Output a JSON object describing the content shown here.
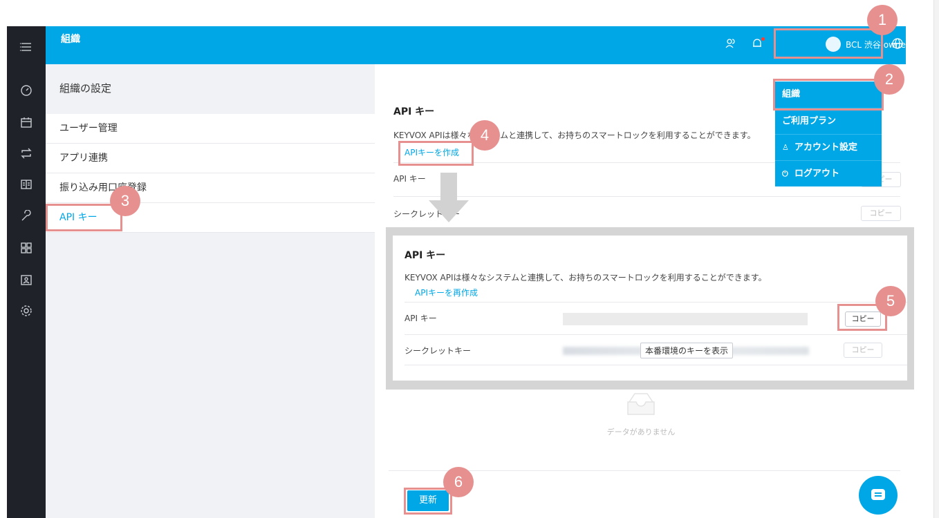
{
  "header": {
    "title": "組織",
    "user_name": "BCL 渋谷 owner",
    "chevron": "∨"
  },
  "subnav": {
    "heading": "組織の設定",
    "items": [
      "ユーザー管理",
      "アプリ連携",
      "振り込み用口座登録",
      "API キー"
    ]
  },
  "api_section": {
    "title": "API キー",
    "description": "KEYVOX APIは様々なシステムと連携して、お持ちのスマートロックを利用することができます。",
    "create_link": "APIキーを作成",
    "api_key_label": "API キー",
    "secret_key_label": "シークレットキー",
    "copy_label": "コピー"
  },
  "callout": {
    "title": "API キー",
    "description": "KEYVOX APIは様々なシステムと連携して、お持ちのスマートロックを利用することができます。",
    "recreate_link": "APIキーを再作成",
    "api_key_label": "API キー",
    "secret_key_label": "シークレットキー",
    "copy_label": "コピー",
    "show_key_button": "本番環境のキーを表示"
  },
  "dropdown": {
    "items": [
      "組織",
      "ご利用プラン",
      "アカウント設定",
      "ログアウト"
    ]
  },
  "empty_text": "データがありません",
  "update_button": "更新",
  "badges": [
    "1",
    "2",
    "3",
    "4",
    "5",
    "6"
  ],
  "colors": {
    "brand": "#00a7e6",
    "highlight": "#e6908f",
    "rail": "#1f2329"
  }
}
